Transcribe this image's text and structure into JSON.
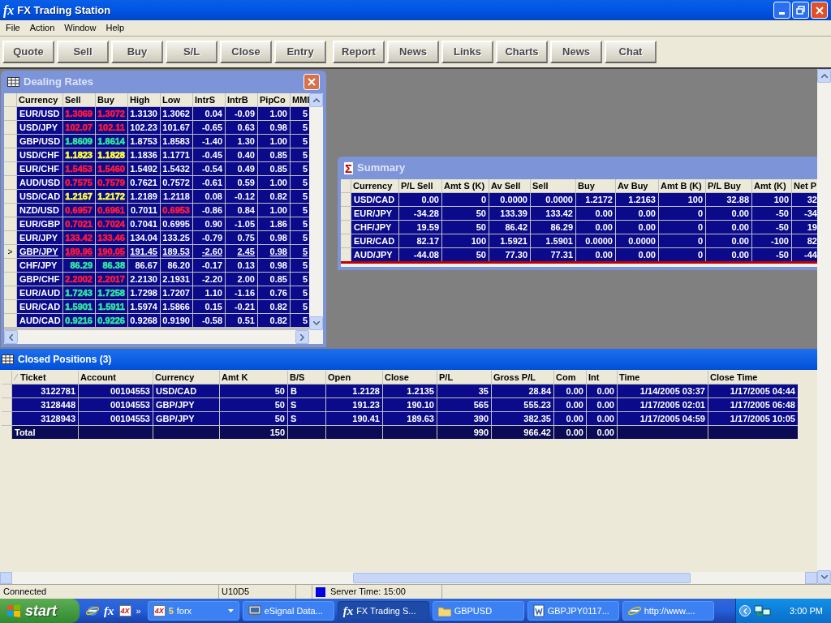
{
  "window": {
    "logo": "fx",
    "title": "FX Trading Station"
  },
  "menu": [
    "File",
    "Action",
    "Window",
    "Help"
  ],
  "toolbar": {
    "groups": [
      [
        "Quote",
        "Sell",
        "Buy",
        "S/L",
        "Close",
        "Entry"
      ],
      [
        "Report",
        "News",
        "Links",
        "Charts",
        "News",
        "Chat"
      ]
    ]
  },
  "dealing_rates": {
    "title": "Dealing Rates",
    "columns": [
      "Currency",
      "Sell",
      "Buy",
      "High",
      "Low",
      "IntrS",
      "IntrB",
      "PipCo",
      "MMI"
    ],
    "rows": [
      {
        "selected": false,
        "cells": [
          "EUR/USD",
          {
            "text": "1.3069",
            "color": "#ff1a3c"
          },
          {
            "text": "1.3072",
            "color": "#ff1a3c"
          },
          "1.3130",
          "1.3062",
          "0.04",
          "-0.09",
          "1.00",
          "5"
        ]
      },
      {
        "selected": false,
        "cells": [
          "USD/JPY",
          {
            "text": "102.07",
            "color": "#ff1a3c"
          },
          {
            "text": "102.11",
            "color": "#ff1a3c"
          },
          "102.23",
          "101.67",
          "-0.65",
          "0.63",
          "0.98",
          "5"
        ]
      },
      {
        "selected": false,
        "cells": [
          "GBP/USD",
          {
            "text": "1.8609",
            "color": "#33e6a0"
          },
          {
            "text": "1.8614",
            "color": "#33e6a0"
          },
          "1.8753",
          "1.8583",
          "-1.40",
          "1.30",
          "1.00",
          "5"
        ]
      },
      {
        "selected": false,
        "cells": [
          "USD/CHF",
          {
            "text": "1.1823",
            "color": "#ffff40"
          },
          {
            "text": "1.1828",
            "color": "#ffff40"
          },
          "1.1836",
          "1.1771",
          "-0.45",
          "0.40",
          "0.85",
          "5"
        ]
      },
      {
        "selected": false,
        "cells": [
          "EUR/CHF",
          {
            "text": "1.5453",
            "color": "#ff1a3c"
          },
          {
            "text": "1.5460",
            "color": "#ff1a3c"
          },
          "1.5492",
          "1.5432",
          "-0.54",
          "0.49",
          "0.85",
          "5"
        ]
      },
      {
        "selected": false,
        "cells": [
          "AUD/USD",
          {
            "text": "0.7575",
            "color": "#ff1a3c"
          },
          {
            "text": "0.7579",
            "color": "#ff1a3c"
          },
          "0.7621",
          "0.7572",
          "-0.61",
          "0.59",
          "1.00",
          "5"
        ]
      },
      {
        "selected": false,
        "cells": [
          "USD/CAD",
          {
            "text": "1.2167",
            "color": "#ffff40"
          },
          {
            "text": "1.2172",
            "color": "#ffff40"
          },
          "1.2189",
          "1.2118",
          "0.08",
          "-0.12",
          "0.82",
          "5"
        ]
      },
      {
        "selected": false,
        "cells": [
          "NZD/USD",
          {
            "text": "0.6957",
            "color": "#ff1a3c"
          },
          {
            "text": "0.6961",
            "color": "#ff1a3c"
          },
          "0.7011",
          {
            "text": "0.6953",
            "color": "#ff1a3c"
          },
          "-0.86",
          "0.84",
          "1.00",
          "5"
        ]
      },
      {
        "selected": false,
        "cells": [
          "EUR/GBP",
          {
            "text": "0.7021",
            "color": "#ff1a3c"
          },
          {
            "text": "0.7024",
            "color": "#ff1a3c"
          },
          "0.7041",
          "0.6995",
          "0.90",
          "-1.05",
          "1.86",
          "5"
        ]
      },
      {
        "selected": false,
        "cells": [
          "EUR/JPY",
          {
            "text": "133.42",
            "color": "#ff1a3c"
          },
          {
            "text": "133.46",
            "color": "#ff1a3c"
          },
          "134.04",
          "133.25",
          "-0.79",
          "0.75",
          "0.98",
          "5"
        ]
      },
      {
        "selected": true,
        "marker": ">",
        "cells": [
          "GBP/JPY",
          {
            "text": "189.96",
            "color": "#ff1a3c"
          },
          {
            "text": "190.05",
            "color": "#ff1a3c"
          },
          "191.45",
          "189.53",
          "-2.60",
          "2.45",
          "0.98",
          "5"
        ]
      },
      {
        "selected": false,
        "cells": [
          "CHF/JPY",
          {
            "text": "86.29",
            "color": "#33e6a0"
          },
          {
            "text": "86.38",
            "color": "#33e6a0"
          },
          "86.67",
          "86.20",
          "-0.17",
          "0.13",
          "0.98",
          "5"
        ]
      },
      {
        "selected": false,
        "cells": [
          "GBP/CHF",
          {
            "text": "2.2002",
            "color": "#ff1a3c"
          },
          {
            "text": "2.2017",
            "color": "#ff1a3c"
          },
          "2.2130",
          "2.1931",
          "-2.20",
          "2.00",
          "0.85",
          "5"
        ]
      },
      {
        "selected": false,
        "cells": [
          "EUR/AUD",
          {
            "text": "1.7243",
            "color": "#33e6a0"
          },
          {
            "text": "1.7258",
            "color": "#33e6a0"
          },
          "1.7298",
          "1.7207",
          "1.10",
          "-1.16",
          "0.76",
          "5"
        ]
      },
      {
        "selected": false,
        "cells": [
          "EUR/CAD",
          {
            "text": "1.5901",
            "color": "#33e6a0"
          },
          {
            "text": "1.5911",
            "color": "#33e6a0"
          },
          "1.5974",
          "1.5866",
          "0.15",
          "-0.21",
          "0.82",
          "5"
        ]
      },
      {
        "selected": false,
        "cells": [
          "AUD/CAD",
          {
            "text": "0.9216",
            "color": "#33e6a0"
          },
          {
            "text": "0.9226",
            "color": "#33e6a0"
          },
          "0.9268",
          "0.9190",
          "-0.58",
          "0.51",
          "0.82",
          "5"
        ]
      }
    ]
  },
  "summary": {
    "icon": "Σ",
    "title": "Summary",
    "columns": [
      "Currency",
      "P/L Sell",
      "Amt S (K)",
      "Av Sell",
      "Sell",
      "Buy",
      "Av Buy",
      "Amt B (K)",
      "P/L Buy",
      "Amt (K)",
      "Net P"
    ],
    "rows": [
      [
        "USD/CAD",
        "0.00",
        "0",
        "0.0000",
        "0.0000",
        "1.2172",
        "1.2163",
        "100",
        "32.88",
        "100",
        "32"
      ],
      [
        "EUR/JPY",
        "-34.28",
        "50",
        "133.39",
        "133.42",
        "0.00",
        "0.00",
        "0",
        "0.00",
        "-50",
        "-34"
      ],
      [
        "CHF/JPY",
        "19.59",
        "50",
        "86.42",
        "86.29",
        "0.00",
        "0.00",
        "0",
        "0.00",
        "-50",
        "19"
      ],
      [
        "EUR/CAD",
        "82.17",
        "100",
        "1.5921",
        "1.5901",
        "0.0000",
        "0.0000",
        "0",
        "0.00",
        "-100",
        "82"
      ],
      [
        "AUD/JPY",
        "-44.08",
        "50",
        "77.30",
        "77.31",
        "0.00",
        "0.00",
        "0",
        "0.00",
        "-50",
        "-44"
      ]
    ]
  },
  "closed_positions": {
    "title": "Closed Positions (3)",
    "columns": [
      "Ticket",
      "Account",
      "Currency",
      "Amt K",
      "B/S",
      "Open",
      "Close",
      "P/L",
      "Gross P/L",
      "Com",
      "Int",
      "Time",
      "Close Time"
    ],
    "rows": [
      {
        "kind": "trade",
        "cells": [
          "3122781",
          "00104553",
          "USD/CAD",
          "50",
          "B",
          "1.2128",
          "1.2135",
          "35",
          "28.84",
          "0.00",
          "0.00",
          "1/14/2005 03:37",
          "1/17/2005 04:44"
        ]
      },
      {
        "kind": "trade",
        "cells": [
          "3128448",
          "00104553",
          "GBP/JPY",
          "50",
          "S",
          "191.23",
          "190.10",
          "565",
          "555.23",
          "0.00",
          "0.00",
          "1/17/2005 02:01",
          "1/17/2005 06:48"
        ]
      },
      {
        "kind": "trade",
        "cells": [
          "3128943",
          "00104553",
          "GBP/JPY",
          "50",
          "S",
          "190.41",
          "189.63",
          "390",
          "382.35",
          "0.00",
          "0.00",
          "1/17/2005 04:59",
          "1/17/2005 10:05"
        ]
      },
      {
        "kind": "total",
        "cells": [
          "Total",
          "",
          "",
          "150",
          "",
          "",
          "",
          "990",
          "966.42",
          "0.00",
          "0.00",
          "",
          ""
        ]
      }
    ]
  },
  "status_bar": {
    "connection": "Connected",
    "account": "U10D5",
    "server_time": "Server Time: 15:00"
  },
  "taskbar": {
    "start": "start",
    "quick_launch": [
      {
        "kind": "browser"
      },
      {
        "kind": "fx",
        "label": "fx"
      },
      {
        "kind": "forex",
        "label": "4X"
      }
    ],
    "chevron": "»",
    "tasks": [
      {
        "kind": "forex",
        "icon_label": "4X",
        "count": "5",
        "label": "forx",
        "selected": false
      },
      {
        "kind": "monitor",
        "label": "eSignal Data...",
        "selected": false
      },
      {
        "kind": "fx",
        "icon_label": "fx",
        "label": "FX Trading S...",
        "selected": true
      },
      {
        "kind": "folder",
        "label": "GBPUSD",
        "selected": false
      },
      {
        "kind": "document",
        "label": "GBPJPY0117...",
        "selected": false
      },
      {
        "kind": "browser",
        "label": "http://www....",
        "selected": false
      }
    ],
    "clock": "3:00 PM"
  }
}
